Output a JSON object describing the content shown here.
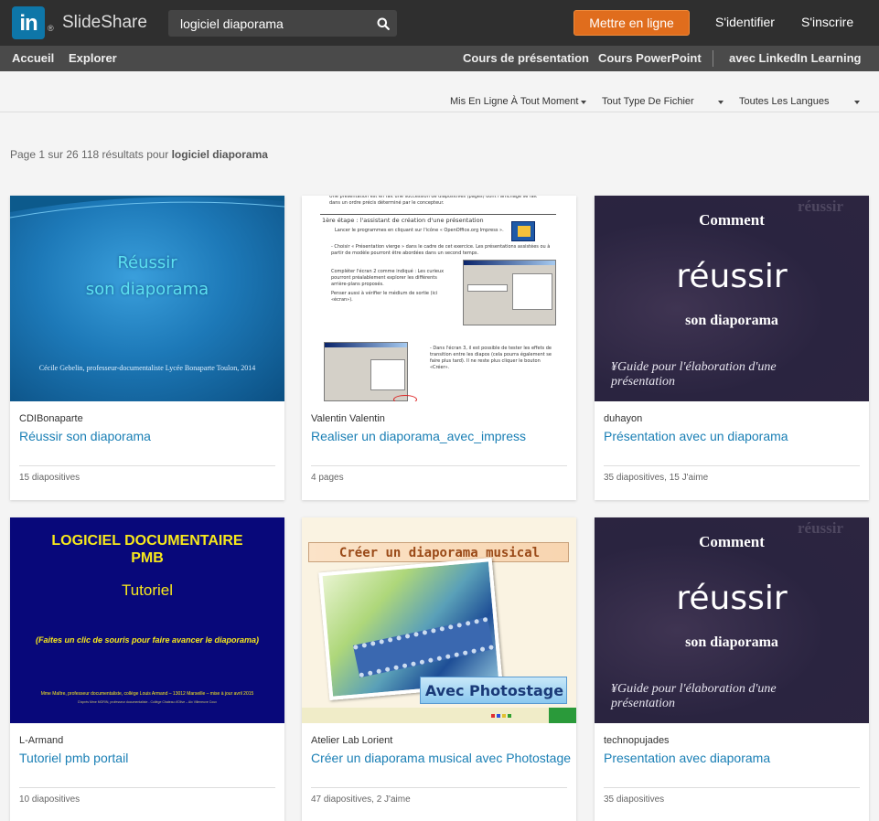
{
  "topbar": {
    "logo_text": "in",
    "logo_reg": "®",
    "brand": "SlideShare",
    "search_value": "logiciel diaporama",
    "upload_label": "Mettre en ligne",
    "login_label": "S'identifier",
    "signup_label": "S'inscrire"
  },
  "nav": {
    "home": "Accueil",
    "explore": "Explorer",
    "courses_presentation": "Cours de présentation",
    "courses_powerpoint": "Cours PowerPoint",
    "linkedin_learning": "avec LinkedIn Learning"
  },
  "filters": {
    "time": "Mis En Ligne À Tout Moment",
    "filetype": "Tout Type De Fichier",
    "language": "Toutes Les Langues"
  },
  "results": {
    "prefix": "Page 1 sur 26 118 résultats pour",
    "query": "logiciel diaporama"
  },
  "colors": {
    "upload_button": "#e06d1d",
    "title_link": "#1a7fb5",
    "linkedin_blue": "#0e76a8"
  },
  "cards": [
    {
      "author": "CDIBonaparte",
      "title": "Réussir son diaporama",
      "meta": "15 diapositives",
      "thumb": {
        "line1": "Réussir",
        "line2": "son diaporama",
        "footer": "Cécile Gebelin, professeur-documentaliste Lycée Bonaparte Toulon, 2014"
      }
    },
    {
      "author": "Valentin Valentin",
      "title": "Realiser un diaporama_avec_impress",
      "meta": "4 pages",
      "thumb": {
        "intro": "Une présentation est en fait une succession de diapositives (pages) dont l'affichage se fait dans un ordre précis déterminé par le concepteur.",
        "step": "1ère étape : l'assistant de création d'une présentation",
        "launch": "Lancer le programmes en cliquant sur l'icône « OpenOffice.org Impress ».",
        "choose": "- Choisir « Présentation vierge » dans le cadre de cet exercice. Les présentations assistées ou à partir de modèle pourront être abordées dans un second temps.",
        "complete": "Compléter l'écran 2 comme indiqué : Les curieux pourront préalablement explorer les différents arrière-plans proposés.",
        "check": "Penser aussi à vérifier le médium de sortie (ici «écran»).",
        "screen3": "- Dans l'écran 3, il est possible de tester les effets de transition entre les diapos (cela pourra également se faire plus tard). Il ne reste plus cliquer le bouton «Créer»."
      }
    },
    {
      "author": "duhayon",
      "title": "Présentation avec un diaporama",
      "meta": "35 diapositives, 15 J'aime",
      "thumb": {
        "watermark": "réussir",
        "line1": "Comment",
        "line2": "réussir",
        "line3": "son diaporama",
        "line4": "¥Guide pour l'élaboration d'une présentation"
      }
    },
    {
      "author": "L-Armand",
      "title": "Tutoriel pmb portail",
      "meta": "10 diapositives",
      "thumb": {
        "line1": "LOGICIEL DOCUMENTAIRE",
        "line2": "PMB",
        "line3": "Tutoriel",
        "line4": "(Faites un clic de souris pour faire avancer le diaporama)",
        "footer": "Mme Maître, professeur documentaliste, collège Louis Armand – 13012 Marseille – mise à jour avril 2015",
        "footer2": "D'après Mme MORIN, professeur documentaliste - Collège Chateau d'Olive – Aix Villeneuve Coux"
      }
    },
    {
      "author": "Atelier Lab Lorient",
      "title": "Créer un diaporama musical avec Photostage",
      "meta": "47 diapositives, 2 J'aime",
      "thumb": {
        "banner": "Créer un diaporama musical",
        "badge": "Avec Photostage"
      }
    },
    {
      "author": "technopujades",
      "title": "Presentation avec diaporama",
      "meta": "35 diapositives",
      "thumb": {
        "watermark": "réussir",
        "line1": "Comment",
        "line2": "réussir",
        "line3": "son diaporama",
        "line4": "¥Guide pour l'élaboration d'une présentation"
      }
    }
  ]
}
